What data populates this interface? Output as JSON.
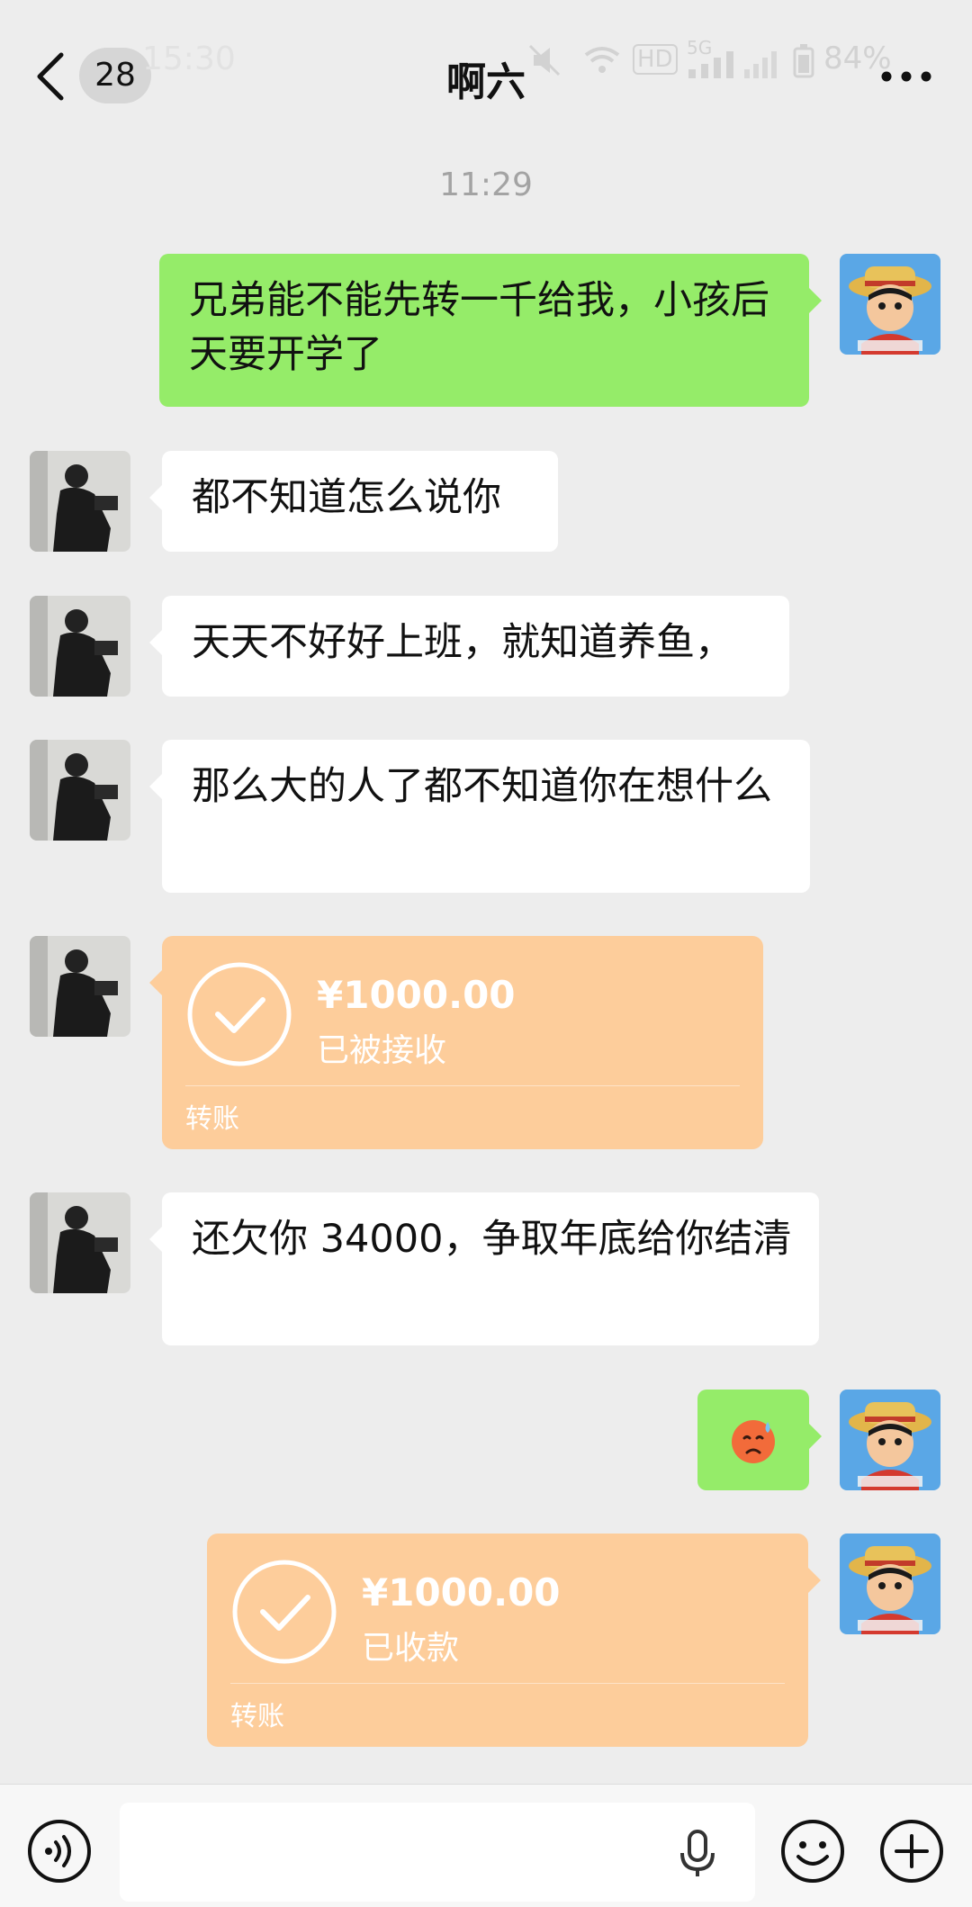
{
  "status_bar": {
    "time": "15:30",
    "battery": "84%",
    "network": "5G",
    "hd": "HD"
  },
  "header": {
    "unread_count": "28",
    "title": "啊六"
  },
  "timestamp": "11:29",
  "messages": [
    {
      "side": "right",
      "type": "text",
      "text": "兄弟能不能先转一千给我，小孩后天要开学了"
    },
    {
      "side": "left",
      "type": "text",
      "text": "都不知道怎么说你"
    },
    {
      "side": "left",
      "type": "text",
      "text": "天天不好好上班，就知道养鱼，"
    },
    {
      "side": "left",
      "type": "text",
      "text": "那么大的人了都不知道你在想什么"
    },
    {
      "side": "left",
      "type": "transfer",
      "amount": "¥1000.00",
      "status": "已被接收",
      "label": "转账"
    },
    {
      "side": "left",
      "type": "text",
      "text": "还欠你 34000，争取年底给你结清"
    },
    {
      "side": "right",
      "type": "emoji",
      "emoji": "sweating-sad-face"
    },
    {
      "side": "right",
      "type": "transfer",
      "amount": "¥1000.00",
      "status": "已收款",
      "label": "转账"
    }
  ],
  "colors": {
    "background": "#ededed",
    "green_bubble": "#95ec69",
    "transfer_bubble": "#fdcd9b",
    "white_bubble": "#ffffff"
  },
  "icons": {
    "back": "chevron-left-icon",
    "more": "more-dots-icon",
    "voice": "voice-icon",
    "mic": "microphone-icon",
    "emoji": "emoji-icon",
    "plus": "plus-icon"
  }
}
